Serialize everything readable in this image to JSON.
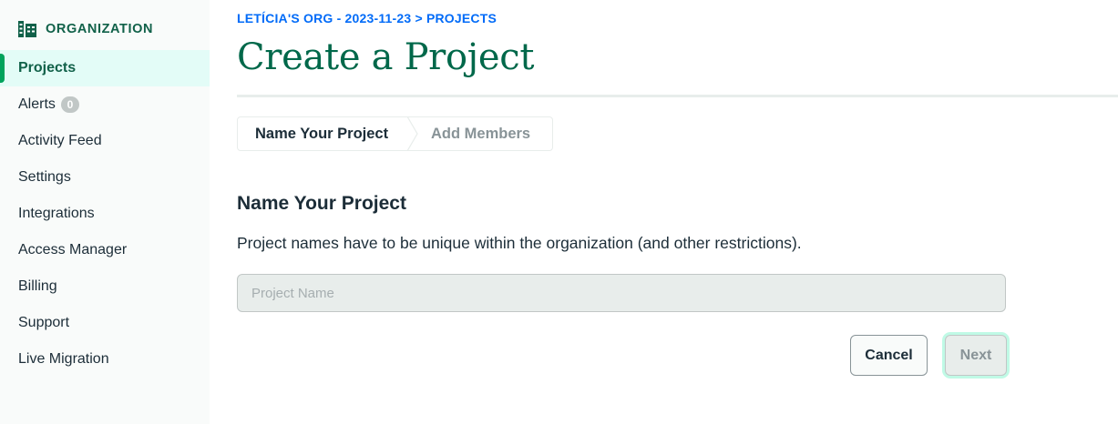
{
  "sidebar": {
    "org_label": "ORGANIZATION",
    "items": [
      {
        "label": "Projects",
        "active": true
      },
      {
        "label": "Alerts",
        "badge": "0"
      },
      {
        "label": "Activity Feed"
      },
      {
        "label": "Settings"
      },
      {
        "label": "Integrations"
      },
      {
        "label": "Access Manager"
      },
      {
        "label": "Billing"
      },
      {
        "label": "Support"
      },
      {
        "label": "Live Migration"
      }
    ]
  },
  "breadcrumb": {
    "org": "LETÍCIA'S ORG - 2023-11-23",
    "separator": " > ",
    "current": "PROJECTS"
  },
  "page_title": "Create a Project",
  "stepper": {
    "steps": [
      {
        "label": "Name Your Project",
        "state": "current"
      },
      {
        "label": "Add Members",
        "state": "upcoming"
      }
    ]
  },
  "form": {
    "section_title": "Name Your Project",
    "description": "Project names have to be unique within the organization (and other restrictions).",
    "name_input": {
      "value": "",
      "placeholder": "Project Name"
    },
    "cancel_label": "Cancel",
    "next_label": "Next"
  },
  "colors": {
    "brand_green": "#00684a",
    "active_bg": "#e3fcf7",
    "link_blue": "#016bf8",
    "text_dark": "#1c2d38",
    "muted_gray": "#889397"
  }
}
